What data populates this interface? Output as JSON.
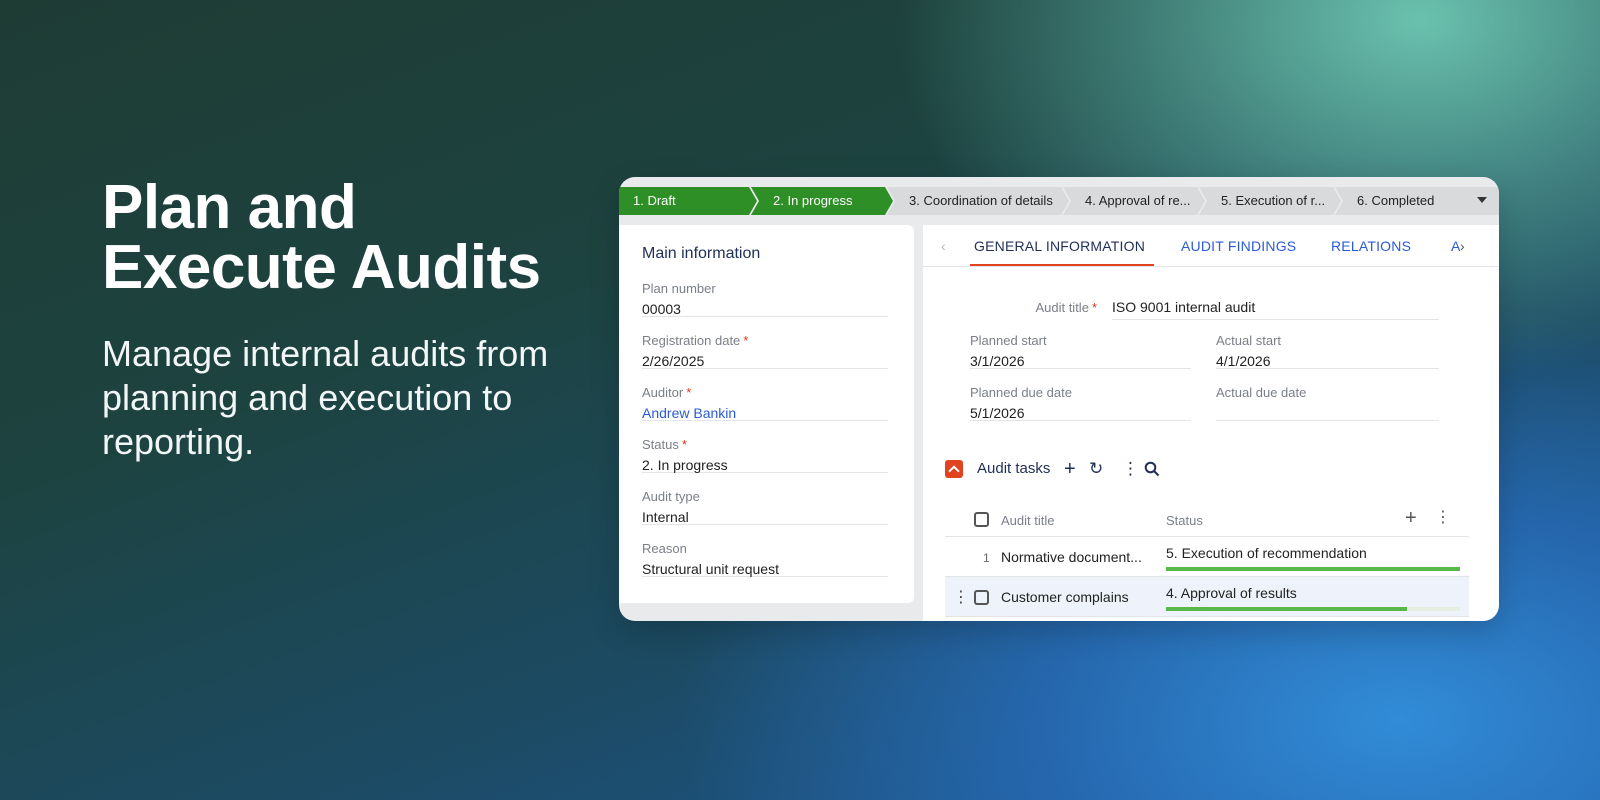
{
  "hero": {
    "title_line1": "Plan and",
    "title_line2": "Execute Audits",
    "subtitle": "Manage internal audits from planning and execution to reporting."
  },
  "stepper": {
    "steps": [
      {
        "label": "1. Draft",
        "state": "done"
      },
      {
        "label": "2. In progress",
        "state": "current"
      },
      {
        "label": "3. Coordination of details",
        "state": "pending"
      },
      {
        "label": "4. Approval of re...",
        "state": "pending"
      },
      {
        "label": "5. Execution of r...",
        "state": "pending"
      },
      {
        "label": "6. Completed",
        "state": "pending"
      }
    ],
    "active_color": "#2f8f27",
    "inactive_color": "#d9dadc"
  },
  "main_info": {
    "heading": "Main information",
    "fields": [
      {
        "label": "Plan number",
        "value": "00003",
        "required": false
      },
      {
        "label": "Registration date",
        "value": "2/26/2025",
        "required": true
      },
      {
        "label": "Auditor",
        "value": "Andrew Bankin",
        "required": true,
        "link": true
      },
      {
        "label": "Status",
        "value": "2. In progress",
        "required": true
      },
      {
        "label": "Audit type",
        "value": "Internal",
        "required": false
      },
      {
        "label": "Reason",
        "value": "Structural unit request",
        "required": false
      }
    ]
  },
  "tabs": {
    "items": [
      "GENERAL INFORMATION",
      "AUDIT FINDINGS",
      "RELATIONS",
      "A"
    ],
    "active": "GENERAL INFORMATION"
  },
  "general": {
    "audit_title_label": "Audit title",
    "audit_title_value": "ISO 9001 internal audit",
    "planned_start_label": "Planned start",
    "planned_start_value": "3/1/2026",
    "actual_start_label": "Actual start",
    "actual_start_value": "4/1/2026",
    "planned_due_label": "Planned due date",
    "planned_due_value": "5/1/2026",
    "actual_due_label": "Actual due date",
    "actual_due_value": ""
  },
  "audit_tasks": {
    "title": "Audit tasks",
    "columns": [
      "Audit title",
      "Status"
    ],
    "rows": [
      {
        "number": "1",
        "title": "Normative document...",
        "status": "5. Execution of recommendation",
        "progress": 1.0
      },
      {
        "number": "",
        "title": "Customer complains",
        "status": "4. Approval of results",
        "progress": 0.82
      }
    ]
  },
  "colors": {
    "accent": "#e2421f",
    "link": "#2a5bd7",
    "progress": "#58b94a"
  }
}
